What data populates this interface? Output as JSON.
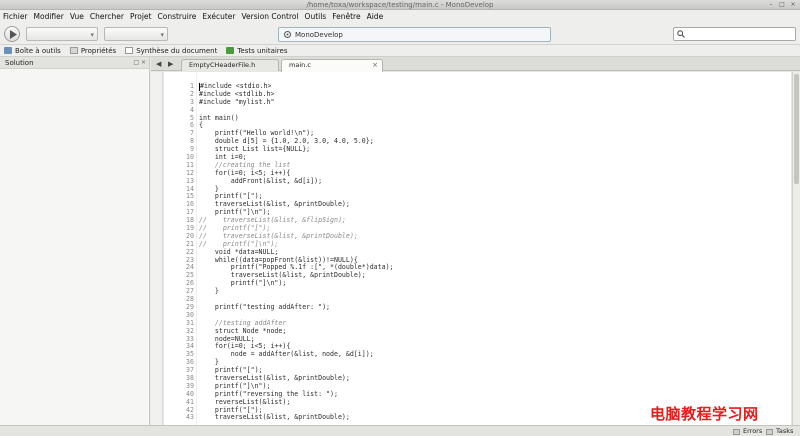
{
  "window": {
    "title": "/home/toxa/workspace/testing/main.c - MonoDevelop",
    "controls": [
      "–",
      "□",
      "×"
    ]
  },
  "menu": [
    "Fichier",
    "Modifier",
    "Vue",
    "Chercher",
    "Projet",
    "Construire",
    "Exécuter",
    "Version Control",
    "Outils",
    "Fenêtre",
    "Aide"
  ],
  "toolbar": {
    "run_icon": "play-icon",
    "status_text": "MonoDevelop",
    "search_placeholder": ""
  },
  "pads": [
    "Boîte à outils",
    "Propriétés",
    "Synthèse du document",
    "Tests unitaires"
  ],
  "solution": {
    "title": "Solution"
  },
  "editor": {
    "tabs": [
      {
        "label": "EmptyCHeaderFile.h",
        "active": false
      },
      {
        "label": "main.c",
        "active": true
      }
    ],
    "lines": [
      {
        "n": "1",
        "code": "#include <stdio.h>"
      },
      {
        "n": "2",
        "code": "#include <stdlib.h>"
      },
      {
        "n": "3",
        "code": "#include \"mylist.h\""
      },
      {
        "n": "4",
        "code": ""
      },
      {
        "n": "5",
        "code": "int main()"
      },
      {
        "n": "6",
        "code": "{"
      },
      {
        "n": "7",
        "code": "    printf(\"Hello world!\\n\");"
      },
      {
        "n": "8",
        "code": "    double d[5] = {1.0, 2.0, 3.0, 4.0, 5.0};"
      },
      {
        "n": "9",
        "code": "    struct List list={NULL};"
      },
      {
        "n": "10",
        "code": "    int i=0;"
      },
      {
        "n": "11",
        "code": "    //creating the list"
      },
      {
        "n": "12",
        "code": "    for(i=0; i<5; i++){"
      },
      {
        "n": "13",
        "code": "        addFront(&list, &d[i]);"
      },
      {
        "n": "14",
        "code": "    }"
      },
      {
        "n": "15",
        "code": "    printf(\"[\");"
      },
      {
        "n": "16",
        "code": "    traverseList(&list, &printDouble);"
      },
      {
        "n": "17",
        "code": "    printf(\"]\\n\");"
      },
      {
        "n": "18",
        "code": "//    traverseList(&list, &flipSign);"
      },
      {
        "n": "19",
        "code": "//    printf(\"[\");"
      },
      {
        "n": "20",
        "code": "//    traverseList(&list, &printDouble);"
      },
      {
        "n": "21",
        "code": "//    printf(\"]\\n\");"
      },
      {
        "n": "22",
        "code": "    void *data=NULL;"
      },
      {
        "n": "23",
        "code": "    while((data=popFront(&list))!=NULL){"
      },
      {
        "n": "24",
        "code": "        printf(\"Popped %.1f :[\", *(double*)data);"
      },
      {
        "n": "25",
        "code": "        traverseList(&list, &printDouble);"
      },
      {
        "n": "26",
        "code": "        printf(\"]\\n\");"
      },
      {
        "n": "27",
        "code": "    }"
      },
      {
        "n": "28",
        "code": ""
      },
      {
        "n": "29",
        "code": "    printf(\"testing addAfter: \");"
      },
      {
        "n": "30",
        "code": ""
      },
      {
        "n": "31",
        "code": "    //testing addAfter"
      },
      {
        "n": "32",
        "code": "    struct Node *node;"
      },
      {
        "n": "33",
        "code": "    node=NULL;"
      },
      {
        "n": "34",
        "code": "    for(i=0; i<5; i++){"
      },
      {
        "n": "35",
        "code": "        node = addAfter(&list, node, &d[i]);"
      },
      {
        "n": "36",
        "code": "    }"
      },
      {
        "n": "37",
        "code": "    printf(\"[\");"
      },
      {
        "n": "38",
        "code": "    traverseList(&list, &printDouble);"
      },
      {
        "n": "39",
        "code": "    printf(\"]\\n\");"
      },
      {
        "n": "40",
        "code": "    printf(\"reversing the list: \");"
      },
      {
        "n": "41",
        "code": "    reverseList(&list);"
      },
      {
        "n": "42",
        "code": "    printf(\"[\");"
      },
      {
        "n": "43",
        "code": "    traverseList(&list, &printDouble);"
      }
    ]
  },
  "statusbar": {
    "errors": "Errors",
    "tasks": "Tasks"
  },
  "watermark": "电脑教程学习网"
}
